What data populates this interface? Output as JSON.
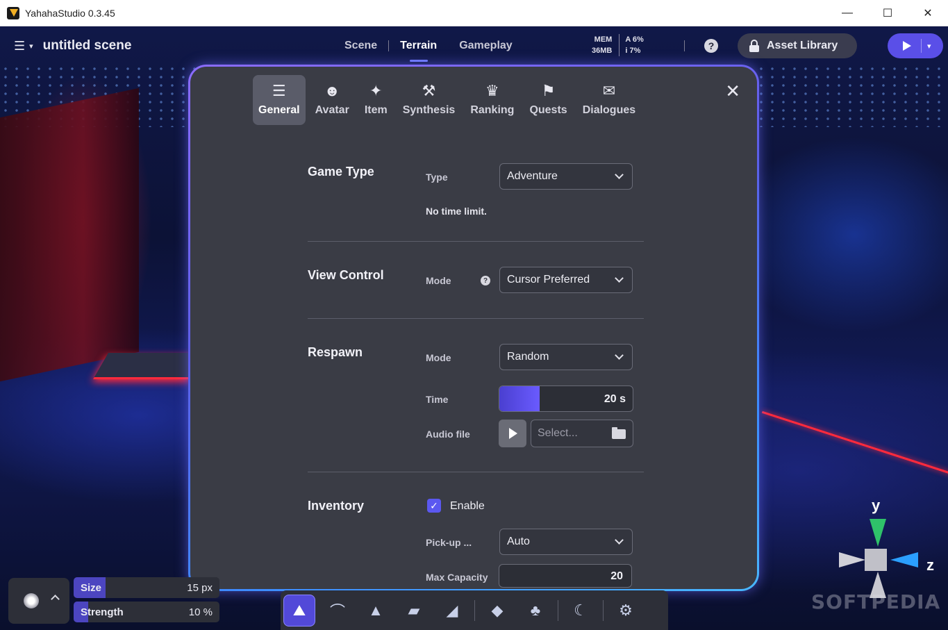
{
  "window": {
    "title": "YahahaStudio 0.3.45",
    "controls": {
      "minimize": "—",
      "maximize": "☐",
      "close": "✕"
    }
  },
  "topbar": {
    "scene_name": "untitled scene",
    "mode_tabs": [
      {
        "label": "Scene"
      },
      {
        "label": "Terrain"
      },
      {
        "label": "Gameplay"
      }
    ],
    "active_mode": "Terrain",
    "stats": {
      "mem_label": "MEM",
      "mem_value": "36MB",
      "a_value": "A  6%",
      "i_value": "i  7%"
    },
    "help_label": "?",
    "asset_library_label": "Asset Library"
  },
  "modal": {
    "tabs": [
      {
        "label": "General",
        "icon": "sliders-icon"
      },
      {
        "label": "Avatar",
        "icon": "avatar-icon"
      },
      {
        "label": "Item",
        "icon": "star-icon"
      },
      {
        "label": "Synthesis",
        "icon": "hammer-icon"
      },
      {
        "label": "Ranking",
        "icon": "trophy-icon"
      },
      {
        "label": "Quests",
        "icon": "flag-icon"
      },
      {
        "label": "Dialogues",
        "icon": "chat-icon"
      }
    ],
    "active_tab": "General",
    "close_label": "✕",
    "game_type": {
      "title": "Game Type",
      "type_label": "Type",
      "type_value": "Adventure",
      "hint": "No time limit."
    },
    "view_control": {
      "title": "View Control",
      "mode_label": "Mode",
      "mode_value": "Cursor Preferred"
    },
    "respawn": {
      "title": "Respawn",
      "mode_label": "Mode",
      "mode_value": "Random",
      "time_label": "Time",
      "time_value": "20 s",
      "time_fraction": 0.3,
      "audio_label": "Audio file",
      "audio_placeholder": "Select..."
    },
    "inventory": {
      "title": "Inventory",
      "enable_label": "Enable",
      "enabled": true,
      "pickup_label": "Pick-up ...",
      "pickup_value": "Auto",
      "capacity_label": "Max Capacity",
      "capacity_value": "20"
    }
  },
  "brush": {
    "size_label": "Size",
    "size_value": "15 px",
    "size_fraction": 0.22,
    "strength_label": "Strength",
    "strength_value": "10 %",
    "strength_fraction": 0.1
  },
  "toolbar_tools": [
    "raise-terrain-icon",
    "smooth-terrain-icon",
    "peak-terrain-icon",
    "flatten-terrain-icon",
    "slope-terrain-icon",
    "paint-terrain-icon",
    "tree-icon",
    "wave-night-icon",
    "settings-terrain-icon"
  ],
  "gizmo": {
    "y_label": "y",
    "z_label": "z"
  },
  "watermark": "SOFTPEDIA"
}
